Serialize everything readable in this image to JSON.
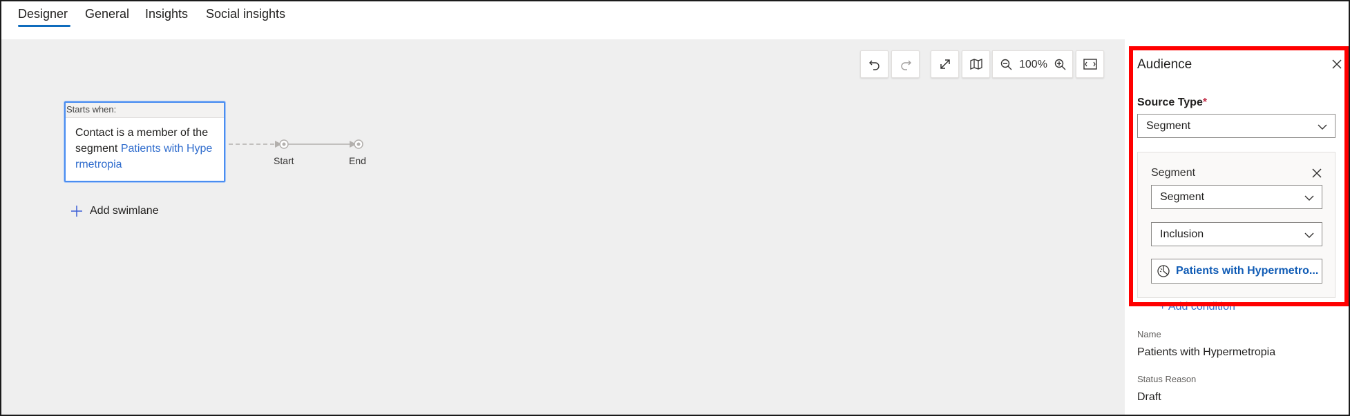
{
  "tabs": [
    {
      "label": "Designer",
      "active": true
    },
    {
      "label": "General",
      "active": false
    },
    {
      "label": "Insights",
      "active": false
    },
    {
      "label": "Social insights",
      "active": false
    }
  ],
  "toolbar": {
    "undo": "undo-icon",
    "redo": "redo-icon",
    "expand": "expand-icon",
    "map": "map-icon",
    "zoom_out": "zoom-out-icon",
    "zoom_level": "100%",
    "zoom_in": "zoom-in-icon",
    "fit": "fit-screen-icon"
  },
  "journey": {
    "starts_when_label": "Starts when:",
    "trigger_text": "Contact is a member of the segment ",
    "segment_link_line1": "Patients with Hype",
    "segment_link_line2": "rmetropia",
    "start_label": "Start",
    "end_label": "End",
    "add_swimlane": "Add swimlane"
  },
  "panel": {
    "title": "Audience",
    "source_type_label": "Source Type",
    "required_mark": "*",
    "source_type_value": "Segment",
    "segment_card": {
      "label": "Segment",
      "type_value": "Segment",
      "inclusion_value": "Inclusion",
      "segment_button": "Patients with Hypermetro..."
    },
    "add_condition": "+ Add condition",
    "name_label": "Name",
    "name_value": "Patients with Hypermetropia",
    "status_label": "Status Reason",
    "status_value": "Draft"
  },
  "colors": {
    "accent": "#0f6cbd",
    "highlight_border": "#ff0000",
    "link": "#2f6ccd",
    "canvas_bg": "#efefef"
  }
}
